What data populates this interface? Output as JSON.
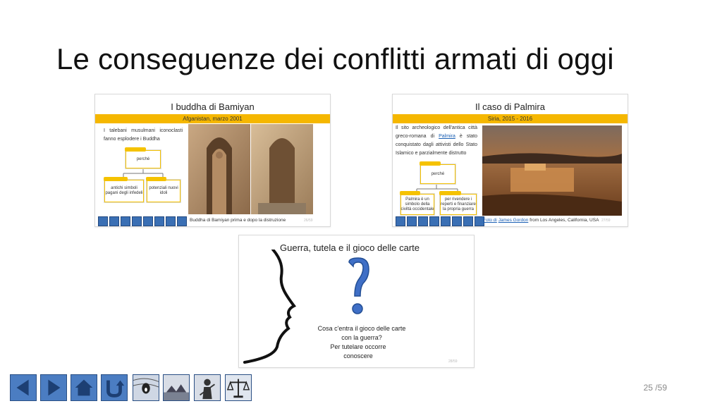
{
  "slide": {
    "title": "Le conseguenze dei conflitti armati di oggi",
    "number": "25 /59"
  },
  "card_bamiyan": {
    "title": "I buddha di Bamiyan",
    "band": "Afganistan, marzo 2001",
    "description": "I talebani musulmani iconoclasti fanno esplodere i Buddha",
    "box_why": "perché",
    "box_left": "antichi simboli pagani degli infedeli",
    "box_right": "potenziali nuovi idoli",
    "caption": "Buddha di Bamiyan prima e dopo la distruzione",
    "page": "26/59"
  },
  "card_palmira": {
    "title": "Il caso di Palmira",
    "band": "Siria, 2015 - 2016",
    "description_before": "Il sito archeologico dell'antica città greco-romana di",
    "description_link": "Palmira",
    "description_after": "è stato conquistato dagli attivisti dello Stato Islamico e parzialmente distrutto",
    "box_why": "perché",
    "box_left": "Palmira è un simbolo della civiltà occidentale",
    "box_right": "per rivendere i reperti e finanziare la propria guerra",
    "caption_link1": "Foto di",
    "caption_link2": "James Gordon",
    "caption_rest": "from Los Angeles, California, USA",
    "page": "27/59"
  },
  "card_game": {
    "title": "Guerra, tutela e il gioco delle carte",
    "question": "Cosa c'entra il gioco delle carte con la guerra?",
    "answer": "Per tutelare occorre conoscere",
    "page": "28/59"
  },
  "nav": {
    "buttons": [
      "back",
      "forward",
      "home",
      "return",
      "scream-image",
      "village-image",
      "soldier-image",
      "scales-image"
    ]
  },
  "colors": {
    "band": "#f5b700",
    "nav_blue": "#4b7dc2",
    "question_mark": "#3f6fc6"
  }
}
